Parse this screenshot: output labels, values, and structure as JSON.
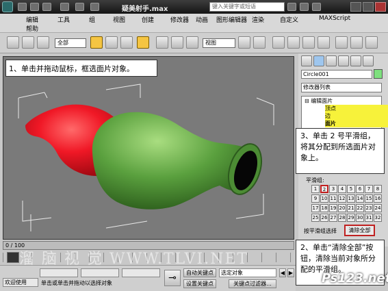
{
  "titlebar": {
    "title": "疑美射手.max",
    "search_placeholder": "键入关键字或短语"
  },
  "menu": {
    "row1": [
      "编辑",
      "工具",
      "组",
      "视图",
      "创建",
      "修改器",
      "动画",
      "图形编辑器",
      "渲染",
      "自定义",
      "MAXScript"
    ],
    "row2": [
      "帮助"
    ]
  },
  "toolbar": {
    "selection_filter": "全部",
    "reference_coord": "视图"
  },
  "viewport": {
    "callout1": "1、单击并拖动鼠标，框选面片对象。"
  },
  "command_panel": {
    "object_name": "Circle001",
    "object_color": "#7ee07e",
    "modifier_list": "修改器列表",
    "stack": {
      "root": "编辑面片",
      "items": [
        "顶点",
        "边",
        "面片"
      ],
      "selected": "面片"
    },
    "callout3": "3、单击 2 号平滑组，将其分配到所选面片对象上。",
    "smoothing_groups_title": "平滑组:",
    "smoothing_groups": [
      "1",
      "2",
      "3",
      "4",
      "5",
      "6",
      "7",
      "8",
      "9",
      "10",
      "11",
      "12",
      "13",
      "14",
      "15",
      "16",
      "17",
      "18",
      "19",
      "20",
      "21",
      "22",
      "23",
      "24",
      "25",
      "26",
      "27",
      "28",
      "29",
      "30",
      "31",
      "32"
    ],
    "selected_group": "2",
    "select_by_sg": "按平滑组选择",
    "clear_all": "清除全部",
    "callout2": "2、单击“清除全部”按钮，清除当前对象所分配的平滑组。"
  },
  "timeline": {
    "frame_indicator": "0 / 100"
  },
  "statusbar": {
    "welcome": "欢迎使用",
    "prompt": "单击或单击并拖动以选择对象",
    "auto_key": "自动关键点",
    "set_key": "设置关键点",
    "selected_object": "选定对象",
    "key_filters": "关键点过滤器..."
  },
  "watermarks": {
    "left": "溜 脑 视 觉  WWW.TLVI.NET",
    "right": "Ps123.net"
  },
  "colors": {
    "left_vase": "#e8182a",
    "right_vase": "#5aa03e",
    "selection_highlight": "#f7f23a",
    "callout_border": "#c02020"
  }
}
